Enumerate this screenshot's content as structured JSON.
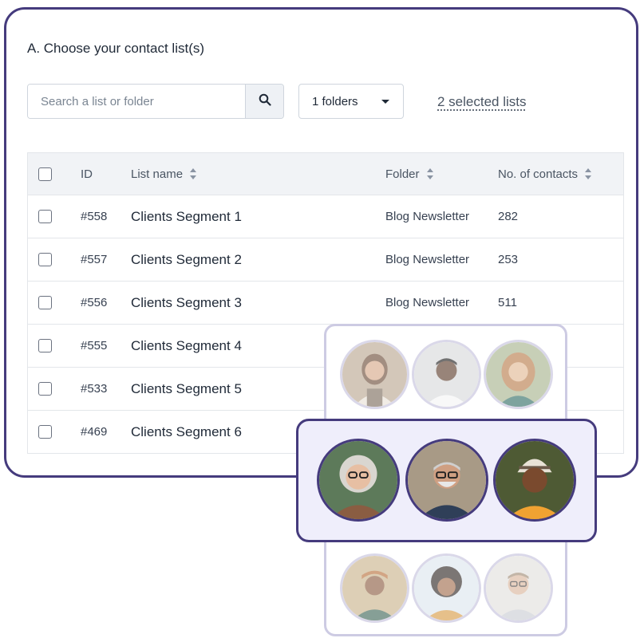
{
  "header": {
    "title": "A. Choose your contact list(s)"
  },
  "search": {
    "placeholder": "Search a list or folder",
    "value": ""
  },
  "folder_filter": {
    "label": "1 folders"
  },
  "selection": {
    "label": "2 selected lists"
  },
  "table": {
    "columns": {
      "id": "ID",
      "name": "List name",
      "folder": "Folder",
      "contacts": "No. of contacts"
    },
    "rows": [
      {
        "id": "#558",
        "name": "Clients Segment 1",
        "folder": "Blog Newsletter",
        "contacts": "282"
      },
      {
        "id": "#557",
        "name": "Clients Segment 2",
        "folder": "Blog Newsletter",
        "contacts": "253"
      },
      {
        "id": "#556",
        "name": "Clients Segment 3",
        "folder": "Blog Newsletter",
        "contacts": "511"
      },
      {
        "id": "#555",
        "name": "Clients Segment 4",
        "folder": "",
        "contacts": ""
      },
      {
        "id": "#533",
        "name": "Clients Segment 5",
        "folder": "",
        "contacts": ""
      },
      {
        "id": "#469",
        "name": "Clients Segment 6",
        "folder": "",
        "contacts": ""
      }
    ]
  },
  "colors": {
    "brand": "#453b7d",
    "highlight_bg": "#efeefb",
    "panel_border": "#cdcbe3"
  },
  "icons": {
    "search": "magnifier-icon",
    "caret": "caret-down-icon",
    "sort": "sort-updown-icon"
  }
}
